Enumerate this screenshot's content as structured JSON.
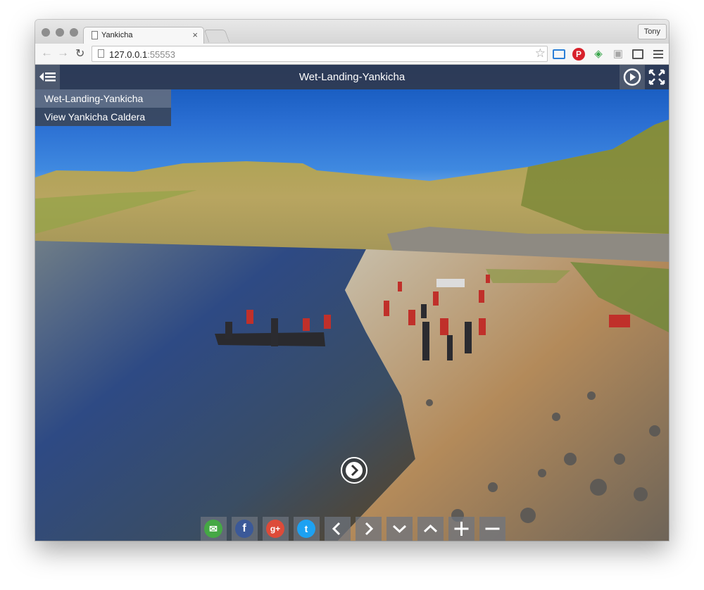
{
  "browser": {
    "tab_title": "Yankicha",
    "tab_close": "×",
    "profile_name": "Tony",
    "url_host": "127.0.0.1",
    "url_port": ":55553",
    "star": "☆",
    "extensions": [
      "cast-icon",
      "pinterest-icon",
      "eye-icon",
      "camera-icon",
      "frame-icon",
      "menu-icon"
    ]
  },
  "viewer": {
    "title": "Wet-Landing-Yankicha",
    "scene_menu": [
      {
        "label": "Wet-Landing-Yankicha",
        "active": true
      },
      {
        "label": "View Yankicha Caldera",
        "active": false
      }
    ],
    "share_buttons": [
      {
        "name": "email",
        "color": "#45a845",
        "glyph": "✉"
      },
      {
        "name": "facebook",
        "color": "#3b5998",
        "glyph": "f"
      },
      {
        "name": "google-plus",
        "color": "#dd4b39",
        "glyph": "g+"
      },
      {
        "name": "twitter",
        "color": "#1da1f2",
        "glyph": "t"
      }
    ],
    "nav_buttons": [
      "left",
      "right",
      "down",
      "up",
      "zoom-in",
      "zoom-out"
    ]
  }
}
